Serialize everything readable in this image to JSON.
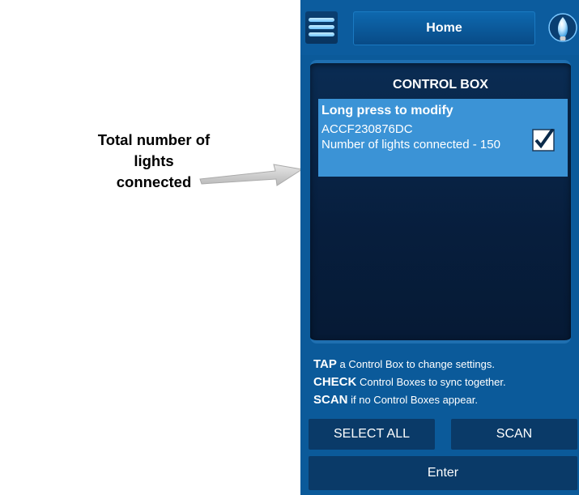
{
  "annotation": {
    "text_line1": "Total number of lights",
    "text_line2": "connected"
  },
  "header": {
    "title": "Home"
  },
  "panel": {
    "title": "CONTROL BOX",
    "items": [
      {
        "title": "Long press to modify",
        "id": "ACCF230876DC",
        "lights": "Number of lights connected - 150",
        "checked": true
      }
    ]
  },
  "instructions": [
    {
      "key": "TAP",
      "text": " a Control Box to change settings."
    },
    {
      "key": "CHECK",
      "text": " Control Boxes to sync together."
    },
    {
      "key": "SCAN",
      "text": " if no Control Boxes appear."
    }
  ],
  "buttons": {
    "select_all": "SELECT ALL",
    "scan": "SCAN",
    "enter": "Enter"
  },
  "colors": {
    "background": "#0b5a9a",
    "panel": "#071e3d",
    "item_selected": "#3b93d6",
    "button": "#0a3a68"
  }
}
